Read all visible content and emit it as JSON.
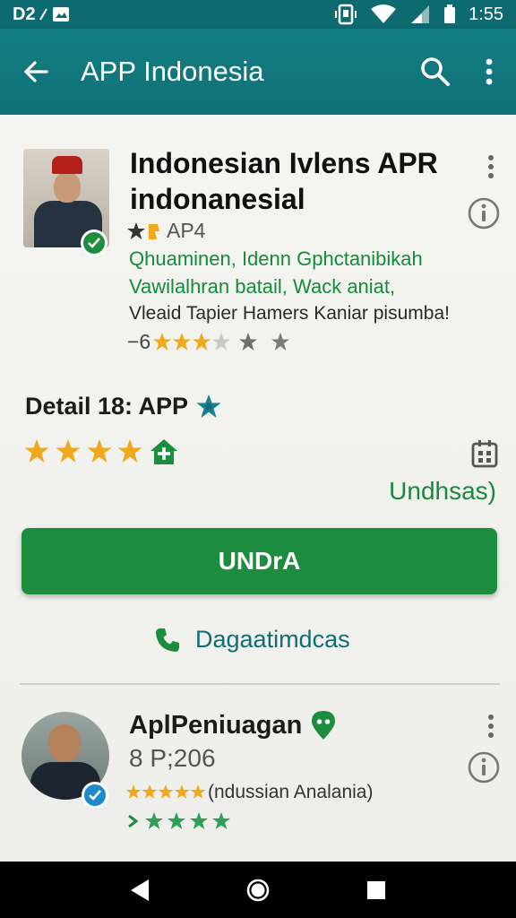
{
  "status_bar": {
    "left_text": "D2",
    "time": "1:55",
    "icons": [
      "notification-icon",
      "photo-icon",
      "vibrate-icon",
      "wifi-icon",
      "signal-icon",
      "battery-icon"
    ]
  },
  "app_bar": {
    "title": "APP Indonesia",
    "back_icon": "arrow-back-icon",
    "search_icon": "search-icon",
    "menu_icon": "more-vert-icon",
    "color": "#137d83"
  },
  "app1": {
    "title": "Indonesian Ivlens APR indonanesial",
    "meta": "AP4",
    "line1": "Qhuaminen, Idenn Gphctanibikah",
    "line2": "Vawilalhran batail, Wack aniat,",
    "line3": "Vleaid Tapier Hamers Kaniar pisumba!",
    "rating_prefix": "−6",
    "rating_stars": 3,
    "rating_total": 6
  },
  "detail": {
    "title": "Detail 18: APP",
    "stars": 4,
    "update_label": "Undhsas)"
  },
  "primary_button": {
    "label": "UNDrA",
    "color": "#1c8c3e"
  },
  "phone_link": {
    "label": "Dagaatimdcas",
    "icon": "phone-icon"
  },
  "app2": {
    "title": "AplPeniuagan",
    "size": "8 P;206",
    "rating_text": "(ndussian Analania)",
    "rating_stars": 5,
    "secondary_stars": 4
  },
  "colors": {
    "accent_green": "#178a3c",
    "teal": "#0f6e75",
    "star_gold": "#f0a91c",
    "star_grey": "#7b7b7b"
  }
}
